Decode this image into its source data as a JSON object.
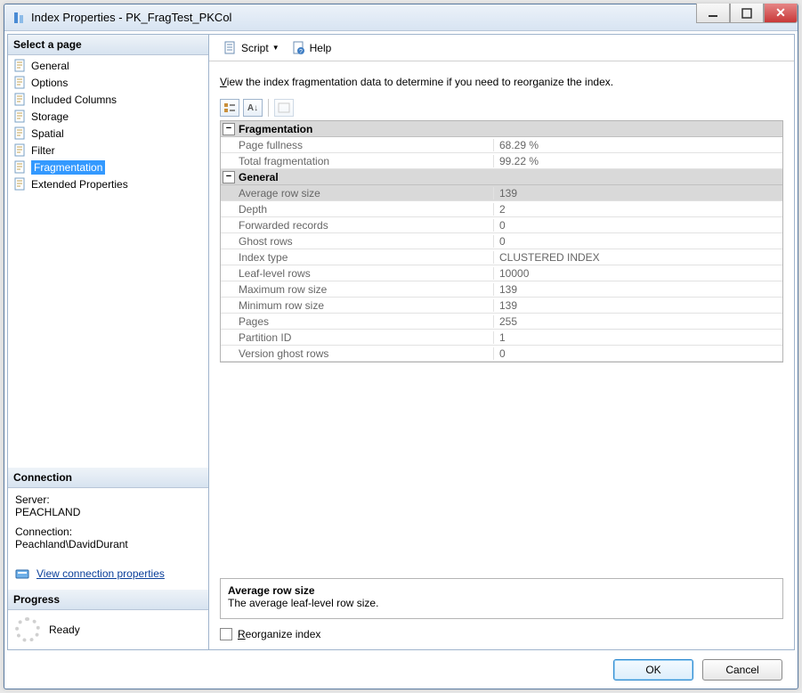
{
  "window": {
    "title": "Index Properties - PK_FragTest_PKCol"
  },
  "toolbar": {
    "script_label": "Script",
    "help_label": "Help"
  },
  "sidebar": {
    "header": "Select a page",
    "items": [
      {
        "label": "General"
      },
      {
        "label": "Options"
      },
      {
        "label": "Included Columns"
      },
      {
        "label": "Storage"
      },
      {
        "label": "Spatial"
      },
      {
        "label": "Filter"
      },
      {
        "label": "Fragmentation"
      },
      {
        "label": "Extended Properties"
      }
    ],
    "selected_index": 6
  },
  "connection": {
    "header": "Connection",
    "server_label": "Server:",
    "server_value": "PEACHLAND",
    "conn_label": "Connection:",
    "conn_value": "Peachland\\DavidDurant",
    "link": "View connection properties"
  },
  "progress": {
    "header": "Progress",
    "status": "Ready"
  },
  "main": {
    "instruction_pre": "V",
    "instruction_rest": "iew the index fragmentation data to determine if you need to reorganize the index.",
    "grid": {
      "sections": [
        {
          "title": "Fragmentation",
          "rows": [
            {
              "label": "Page fullness",
              "value": "68.29 %"
            },
            {
              "label": "Total fragmentation",
              "value": "99.22 %"
            }
          ]
        },
        {
          "title": "General",
          "rows": [
            {
              "label": "Average row size",
              "value": "139",
              "selected": true
            },
            {
              "label": "Depth",
              "value": "2"
            },
            {
              "label": "Forwarded records",
              "value": "0"
            },
            {
              "label": "Ghost rows",
              "value": "0"
            },
            {
              "label": "Index type",
              "value": "CLUSTERED INDEX"
            },
            {
              "label": "Leaf-level rows",
              "value": "10000"
            },
            {
              "label": "Maximum row size",
              "value": "139"
            },
            {
              "label": "Minimum row size",
              "value": "139"
            },
            {
              "label": "Pages",
              "value": "255"
            },
            {
              "label": "Partition ID",
              "value": "1"
            },
            {
              "label": "Version ghost rows",
              "value": "0"
            }
          ]
        }
      ]
    },
    "description": {
      "title": "Average row size",
      "text": "The average leaf-level row size."
    },
    "reorganize_pre": "R",
    "reorganize_rest": "eorganize index"
  },
  "buttons": {
    "ok": "OK",
    "cancel": "Cancel"
  }
}
